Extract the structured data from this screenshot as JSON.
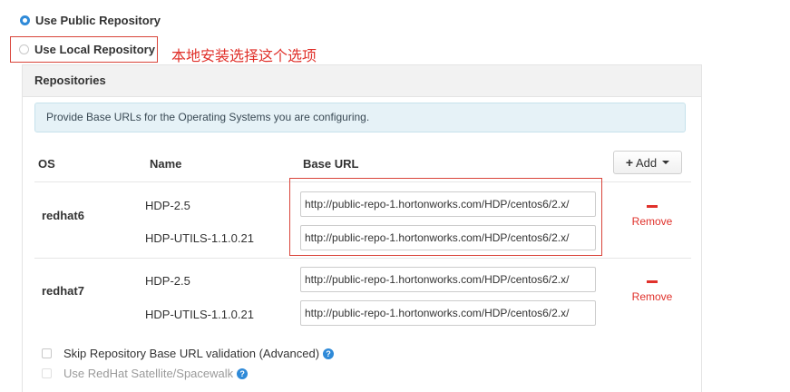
{
  "repo_source": {
    "public_label": "Use Public Repository",
    "local_label": "Use Local Repository",
    "selected": "public"
  },
  "annotation_text": "本地安装选择这个选项",
  "panel": {
    "title": "Repositories",
    "info": "Provide Base URLs for the Operating Systems you are configuring.",
    "columns": {
      "os": "OS",
      "name": "Name",
      "base_url": "Base URL"
    },
    "add_button": "Add",
    "remove_label": "Remove",
    "groups": [
      {
        "os": "redhat6",
        "repos": [
          {
            "name": "HDP-2.5",
            "url": "http://public-repo-1.hortonworks.com/HDP/centos6/2.x/"
          },
          {
            "name": "HDP-UTILS-1.1.0.21",
            "url": "http://public-repo-1.hortonworks.com/HDP/centos6/2.x/"
          }
        ]
      },
      {
        "os": "redhat7",
        "repos": [
          {
            "name": "HDP-2.5",
            "url": "http://public-repo-1.hortonworks.com/HDP/centos6/2.x/"
          },
          {
            "name": "HDP-UTILS-1.1.0.21",
            "url": "http://public-repo-1.hortonworks.com/HDP/centos6/2.x/"
          }
        ]
      }
    ]
  },
  "options": {
    "skip_validation": "Skip Repository Base URL validation (Advanced)",
    "satellite": "Use RedHat Satellite/Spacewalk"
  },
  "colors": {
    "accent": "#2f8ad8",
    "annotation": "#e0312b",
    "remove": "#e0312b"
  }
}
